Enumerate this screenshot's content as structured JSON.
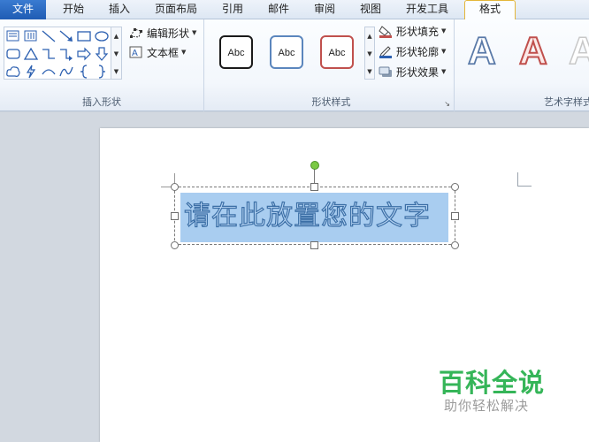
{
  "tabs": [
    {
      "label": "文件"
    },
    {
      "label": "开始"
    },
    {
      "label": "插入"
    },
    {
      "label": "页面布局"
    },
    {
      "label": "引用"
    },
    {
      "label": "邮件"
    },
    {
      "label": "审阅"
    },
    {
      "label": "视图"
    },
    {
      "label": "开发工具"
    },
    {
      "label": "格式"
    }
  ],
  "ribbon": {
    "insert_shapes": {
      "label": "插入形状",
      "edit_shape": "编辑形状",
      "text_box": "文本框"
    },
    "shape_styles": {
      "label": "形状样式",
      "presets": [
        {
          "text": "Abc",
          "border": "#1a1a1a"
        },
        {
          "text": "Abc",
          "border": "#5b86bd"
        },
        {
          "text": "Abc",
          "border": "#c0504d"
        }
      ],
      "shape_fill": "形状填充",
      "shape_outline": "形状轮廓",
      "shape_effects": "形状效果"
    },
    "word_art": {
      "label": "艺术字样式",
      "letters": [
        "A",
        "A",
        "A"
      ]
    }
  },
  "document": {
    "wordart_text": "请在此放置您的文字"
  },
  "watermark": {
    "title": "百科全说",
    "subtitle": "助你轻松解决"
  },
  "colors": {
    "accent_blue": "#2b5fb0",
    "selection": "#a9cdf0",
    "rotate_handle": "#7ac943",
    "watermark_green": "#35b558"
  }
}
